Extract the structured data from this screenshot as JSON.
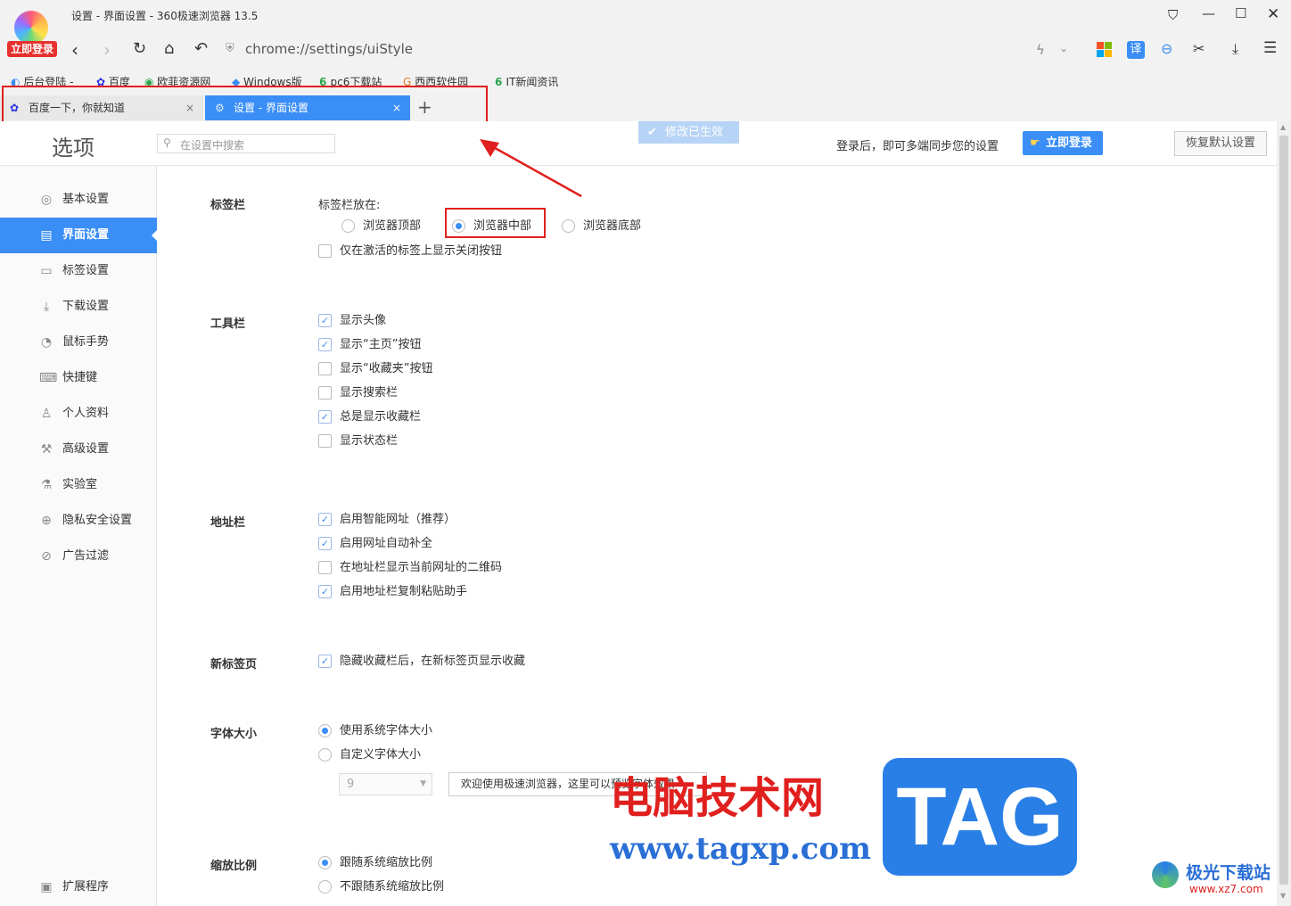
{
  "window": {
    "title": "设置 - 界面设置 - 360极速浏览器 13.5",
    "login_badge": "立即登录"
  },
  "toolbar": {
    "url": "chrome://settings/uiStyle",
    "translate_label": "译"
  },
  "bookmarks": [
    "后台登陆 -",
    "百度",
    "欧菲资源网",
    "Windows版",
    "pc6下载站",
    "西西软件园",
    "IT新闻资讯"
  ],
  "tabs": [
    {
      "label": "百度一下，你就知道",
      "close": "×"
    },
    {
      "label": "设置 - 界面设置",
      "close": "×"
    }
  ],
  "new_tab": "+",
  "header": {
    "title": "选项",
    "search_placeholder": "在设置中搜索",
    "saved_notice": "修改已生效",
    "sync_text": "登录后，即可多端同步您的设置",
    "login_button": "立即登录",
    "reset_button": "恢复默认设置"
  },
  "sidebar": {
    "items": [
      "基本设置",
      "界面设置",
      "标签设置",
      "下载设置",
      "鼠标手势",
      "快捷键",
      "个人资料",
      "高级设置",
      "实验室",
      "隐私安全设置",
      "广告过滤"
    ],
    "extensions": "扩展程序"
  },
  "tabbar": {
    "section": "标签栏",
    "position_label": "标签栏放在:",
    "radios": [
      "浏览器顶部",
      "浏览器中部",
      "浏览器底部"
    ],
    "selected": 1,
    "close_btn_label": "仅在激活的标签上显示关闭按钮",
    "close_btn_checked": false
  },
  "toolbar_section": {
    "section": "工具栏",
    "options": [
      {
        "label": "显示头像",
        "checked": true
      },
      {
        "label": "显示“主页”按钮",
        "checked": true
      },
      {
        "label": "显示“收藏夹”按钮",
        "checked": false
      },
      {
        "label": "显示搜索栏",
        "checked": false
      },
      {
        "label": "总是显示收藏栏",
        "checked": true
      },
      {
        "label": "显示状态栏",
        "checked": false
      }
    ]
  },
  "address_section": {
    "section": "地址栏",
    "options": [
      {
        "label": "启用智能网址（推荐）",
        "checked": true
      },
      {
        "label": "启用网址自动补全",
        "checked": true
      },
      {
        "label": "在地址栏显示当前网址的二维码",
        "checked": false
      },
      {
        "label": "启用地址栏复制粘贴助手",
        "checked": true
      }
    ]
  },
  "newtab_section": {
    "section": "新标签页",
    "options": [
      {
        "label": "隐藏收藏栏后，在新标签页显示收藏",
        "checked": true
      }
    ]
  },
  "font_section": {
    "section": "字体大小",
    "options": [
      "使用系统字体大小",
      "自定义字体大小"
    ],
    "selected": 0,
    "size_value": "9",
    "preview_text": "欢迎使用极速浏览器，这里可以预览字体效果"
  },
  "zoom_section": {
    "section": "缩放比例",
    "options": [
      "跟随系统缩放比例",
      "不跟随系统缩放比例"
    ],
    "selected": 0
  },
  "watermark": {
    "site_cn": "电脑技术网",
    "site_url": "www.tagxp.com",
    "tag": "TAG",
    "corner_cn": "极光下载站",
    "corner_url": "www.xz7.com"
  },
  "colors": {
    "accent": "#3a8ef6",
    "highlight": "#e0201e"
  }
}
